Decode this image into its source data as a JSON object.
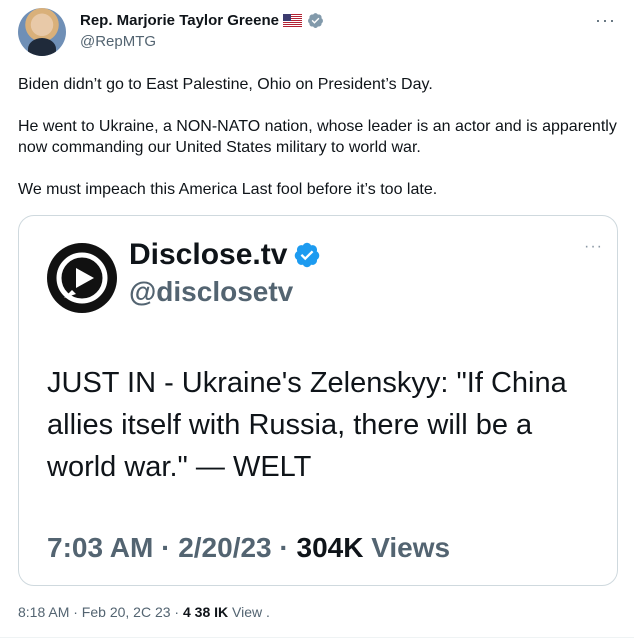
{
  "tweet": {
    "author_name": "Rep. Marjorie Taylor Greene",
    "author_handle": "@RepMTG",
    "more_icon": "more-horizontal-icon",
    "paragraphs": [
      "Biden didn’t go to East Palestine, Ohio on President’s Day.",
      "He went to Ukraine, a NON-NATO nation, whose leader is an actor and is apparently now commanding our United States military to world war.",
      "We must impeach this America Last fool before it’s too late."
    ],
    "timestamp": "8:18 AM · Feb 20, 2C 23 · ",
    "views_count": "4 38 IK",
    "views_label": "View ."
  },
  "quoted": {
    "name": "Disclose.tv",
    "handle": "@disclosetv",
    "text": "JUST IN - Ukraine's Zelenskyy: \"If China allies itself with Russia, there will be a world war.\" — WELT",
    "meta_time": "7:03 AM · 2/20/23 · ",
    "meta_views_count": "304K",
    "meta_views_label": " Views"
  },
  "colors": {
    "verified_blue": "#1d9bf0",
    "text_primary": "#0f1419",
    "text_secondary": "#536471",
    "border": "#cfd9de"
  }
}
